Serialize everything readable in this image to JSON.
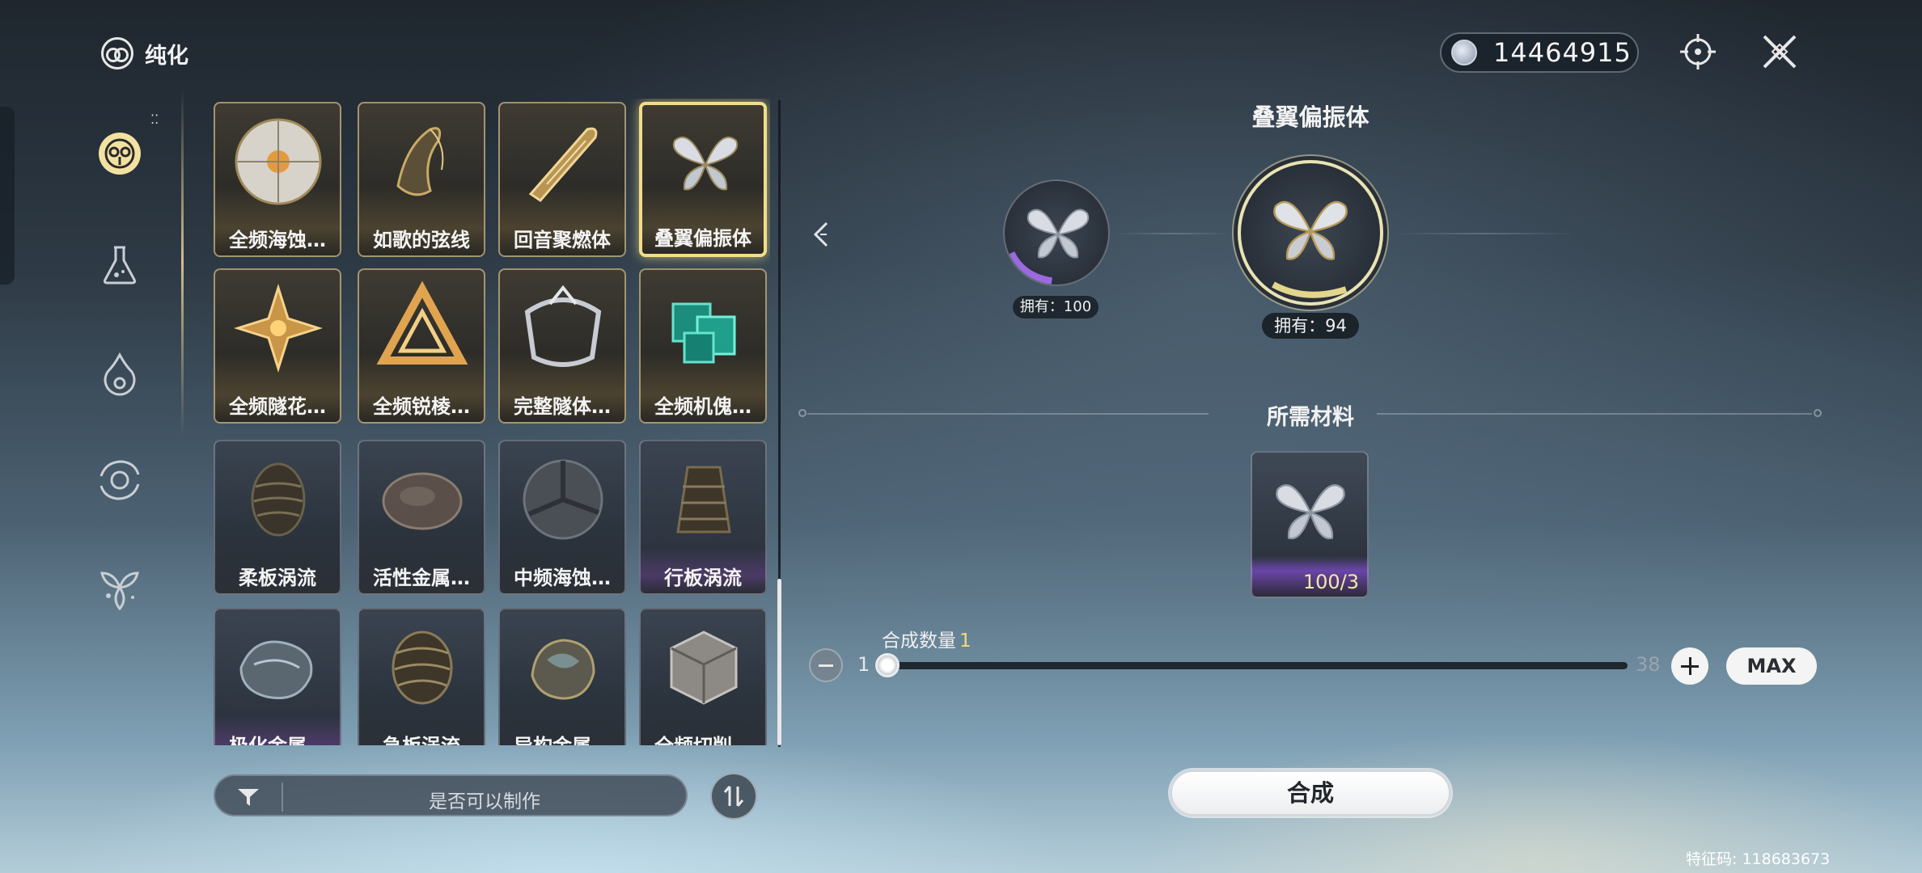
{
  "header": {
    "title": "纯化",
    "currency_value": "14464915"
  },
  "sidebar": {
    "items": [
      {
        "name": "purify",
        "active": true
      },
      {
        "name": "potion",
        "active": false
      },
      {
        "name": "flame",
        "active": false
      },
      {
        "name": "cycle",
        "active": false
      },
      {
        "name": "flower",
        "active": false
      }
    ]
  },
  "grid": {
    "items": [
      {
        "label": "全频海蚀…",
        "style": "gold"
      },
      {
        "label": "如歌的弦线",
        "style": "gold"
      },
      {
        "label": "回音聚燃体",
        "style": "gold"
      },
      {
        "label": "叠翼偏振体",
        "style": "gold",
        "selected": true
      },
      {
        "label": "全频隧花…",
        "style": "gold"
      },
      {
        "label": "全频锐棱…",
        "style": "gold"
      },
      {
        "label": "完整隧体…",
        "style": "gold"
      },
      {
        "label": "全频机傀…",
        "style": "gold"
      },
      {
        "label": "柔板涡流",
        "style": "blue"
      },
      {
        "label": "活性金属…",
        "style": "blue"
      },
      {
        "label": "中频海蚀…",
        "style": "blue"
      },
      {
        "label": "行板涡流",
        "style": "purple"
      },
      {
        "label": "极化金属…",
        "style": "purple"
      },
      {
        "label": "急板涡流",
        "style": "blue"
      },
      {
        "label": "异构金属…",
        "style": "blue"
      },
      {
        "label": "全频切削…",
        "style": "blue"
      }
    ]
  },
  "filter": {
    "label": "是否可以制作"
  },
  "detail": {
    "title": "叠翼偏振体",
    "source_owned": "拥有：100",
    "target_owned": "拥有：94",
    "materials_title": "所需材料",
    "material_count": "100/3"
  },
  "quantity": {
    "label": "合成数量",
    "value": "1",
    "min": "1",
    "max": "38",
    "max_button": "MAX"
  },
  "craft_button": "合成",
  "uid": "特征码: 118683673",
  "colors": {
    "accent_gold": "#f1dd8a",
    "rarity_purple": "#6a45a8"
  }
}
